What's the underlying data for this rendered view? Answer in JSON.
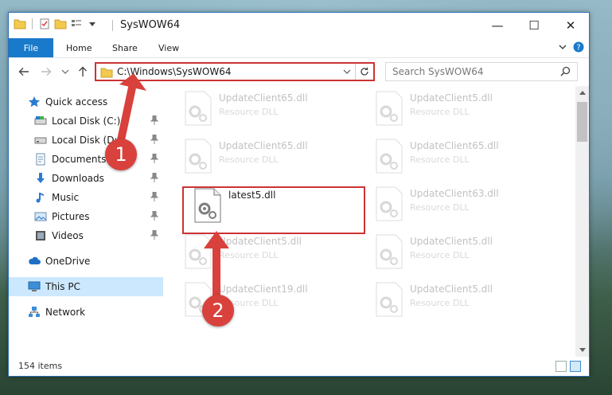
{
  "window": {
    "title": "SysWOW64",
    "controls": {
      "minimize": "—",
      "maximize": "☐",
      "close": "✕"
    }
  },
  "ribbon": {
    "tabs": [
      {
        "label": "File",
        "active": true
      },
      {
        "label": "Home"
      },
      {
        "label": "Share"
      },
      {
        "label": "View"
      }
    ]
  },
  "navigation": {
    "address": "C:\\Windows\\SysWOW64",
    "search_placeholder": "Search SysWOW64"
  },
  "sidebar": {
    "items": [
      {
        "label": "Quick access",
        "icon": "star-icon"
      },
      {
        "label": "Local Disk (C:)",
        "icon": "drive-icon",
        "pinned": true
      },
      {
        "label": "Local Disk (D:)",
        "icon": "drive-icon",
        "pinned": true
      },
      {
        "label": "Documents",
        "icon": "documents-icon",
        "pinned": true
      },
      {
        "label": "Downloads",
        "icon": "download-icon",
        "pinned": true
      },
      {
        "label": "Music",
        "icon": "music-icon",
        "pinned": true
      },
      {
        "label": "Pictures",
        "icon": "pictures-icon",
        "pinned": true
      },
      {
        "label": "Videos",
        "icon": "videos-icon",
        "pinned": true
      },
      {
        "label": "OneDrive",
        "icon": "cloud-icon"
      },
      {
        "label": "This PC",
        "icon": "computer-icon",
        "selected": true
      },
      {
        "label": "Network",
        "icon": "network-icon"
      }
    ]
  },
  "files": [
    {
      "name": "UpdateClient65.dll",
      "type": "Resource DLL",
      "faded": true
    },
    {
      "name": "UpdateClient5.dll",
      "type": "Resource DLL",
      "faded": true
    },
    {
      "name": "UpdateClient65.dll",
      "type": "Resource DLL",
      "faded": true
    },
    {
      "name": "UpdateClient65.dll",
      "type": "Resource DLL",
      "faded": true
    },
    {
      "name": "latest5.dll",
      "type": "",
      "faded": false,
      "highlighted": true
    },
    {
      "name": "UpdateClient63.dll",
      "type": "Resource DLL",
      "faded": true
    },
    {
      "name": "UpdateClient5.dll",
      "type": "Resource DLL",
      "faded": true
    },
    {
      "name": "UpdateClient5.dll",
      "type": "Resource DLL",
      "faded": true
    },
    {
      "name": "UpdateClient19.dll",
      "type": "Resource DLL",
      "faded": true
    },
    {
      "name": "UpdateClient5.dll",
      "type": "Resource DLL",
      "faded": true
    }
  ],
  "status": {
    "item_count": "154 items"
  },
  "annotations": {
    "step1": "1",
    "step2": "2"
  },
  "colors": {
    "accent": "#1979ca",
    "highlight": "#cc3333",
    "callout": "#d9413c",
    "selected": "#cce8ff"
  }
}
